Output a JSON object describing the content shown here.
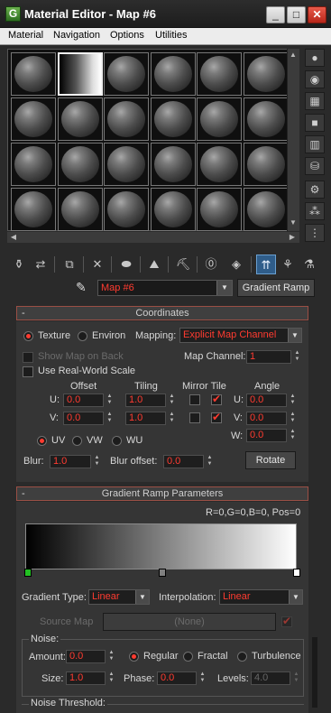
{
  "window": {
    "title": "Material Editor - Map #6",
    "icon_letter": "G",
    "minimize": "_",
    "maximize": "□",
    "close": "✕"
  },
  "menu": [
    "Material",
    "Navigation",
    "Options",
    "Utilities"
  ],
  "slots": {
    "rows": 4,
    "cols": 6,
    "selected_index": 1
  },
  "map": {
    "name": "Map #6",
    "type_button": "Gradient Ramp"
  },
  "coordinates": {
    "title": "Coordinates",
    "collapse": "-",
    "texture_label": "Texture",
    "environ_label": "Environ",
    "mapping_label": "Mapping:",
    "mapping_value": "Explicit Map Channel",
    "show_map_on_back": "Show Map on Back",
    "map_channel_label": "Map Channel:",
    "map_channel_value": "1",
    "use_real_world_scale": "Use Real-World Scale",
    "headers": {
      "offset": "Offset",
      "tiling": "Tiling",
      "mirror_tile": "Mirror Tile",
      "angle": "Angle"
    },
    "u_label": "U:",
    "v_label": "V:",
    "w_label": "W:",
    "u_offset": "0.0",
    "v_offset": "0.0",
    "u_tiling": "1.0",
    "v_tiling": "1.0",
    "u_mirror": false,
    "u_tile": true,
    "v_mirror": false,
    "v_tile": true,
    "u_angle": "0.0",
    "v_angle": "0.0",
    "w_angle": "0.0",
    "uv_label": "UV",
    "vw_label": "VW",
    "wu_label": "WU",
    "blur_label": "Blur:",
    "blur_value": "1.0",
    "blur_offset_label": "Blur offset:",
    "blur_offset_value": "0.0",
    "rotate_button": "Rotate"
  },
  "gradient": {
    "title": "Gradient Ramp Parameters",
    "collapse": "-",
    "flag_info": "R=0,G=0,B=0, Pos=0",
    "gradient_type_label": "Gradient Type:",
    "gradient_type_value": "Linear",
    "interpolation_label": "Interpolation:",
    "interpolation_value": "Linear",
    "source_map_label": "Source Map",
    "source_map_value": "(None)",
    "noise_group": "Noise:",
    "amount_label": "Amount:",
    "amount_value": "0.0",
    "regular_label": "Regular",
    "fractal_label": "Fractal",
    "turbulence_label": "Turbulence",
    "size_label": "Size:",
    "size_value": "1.0",
    "phase_label": "Phase:",
    "phase_value": "0.0",
    "levels_label": "Levels:",
    "levels_value": "4.0",
    "noise_threshold": "Noise Threshold:"
  },
  "colors": {
    "accent_red": "#ff3b30",
    "selected_flag": "#22c022",
    "background": "#2a2a2a"
  }
}
